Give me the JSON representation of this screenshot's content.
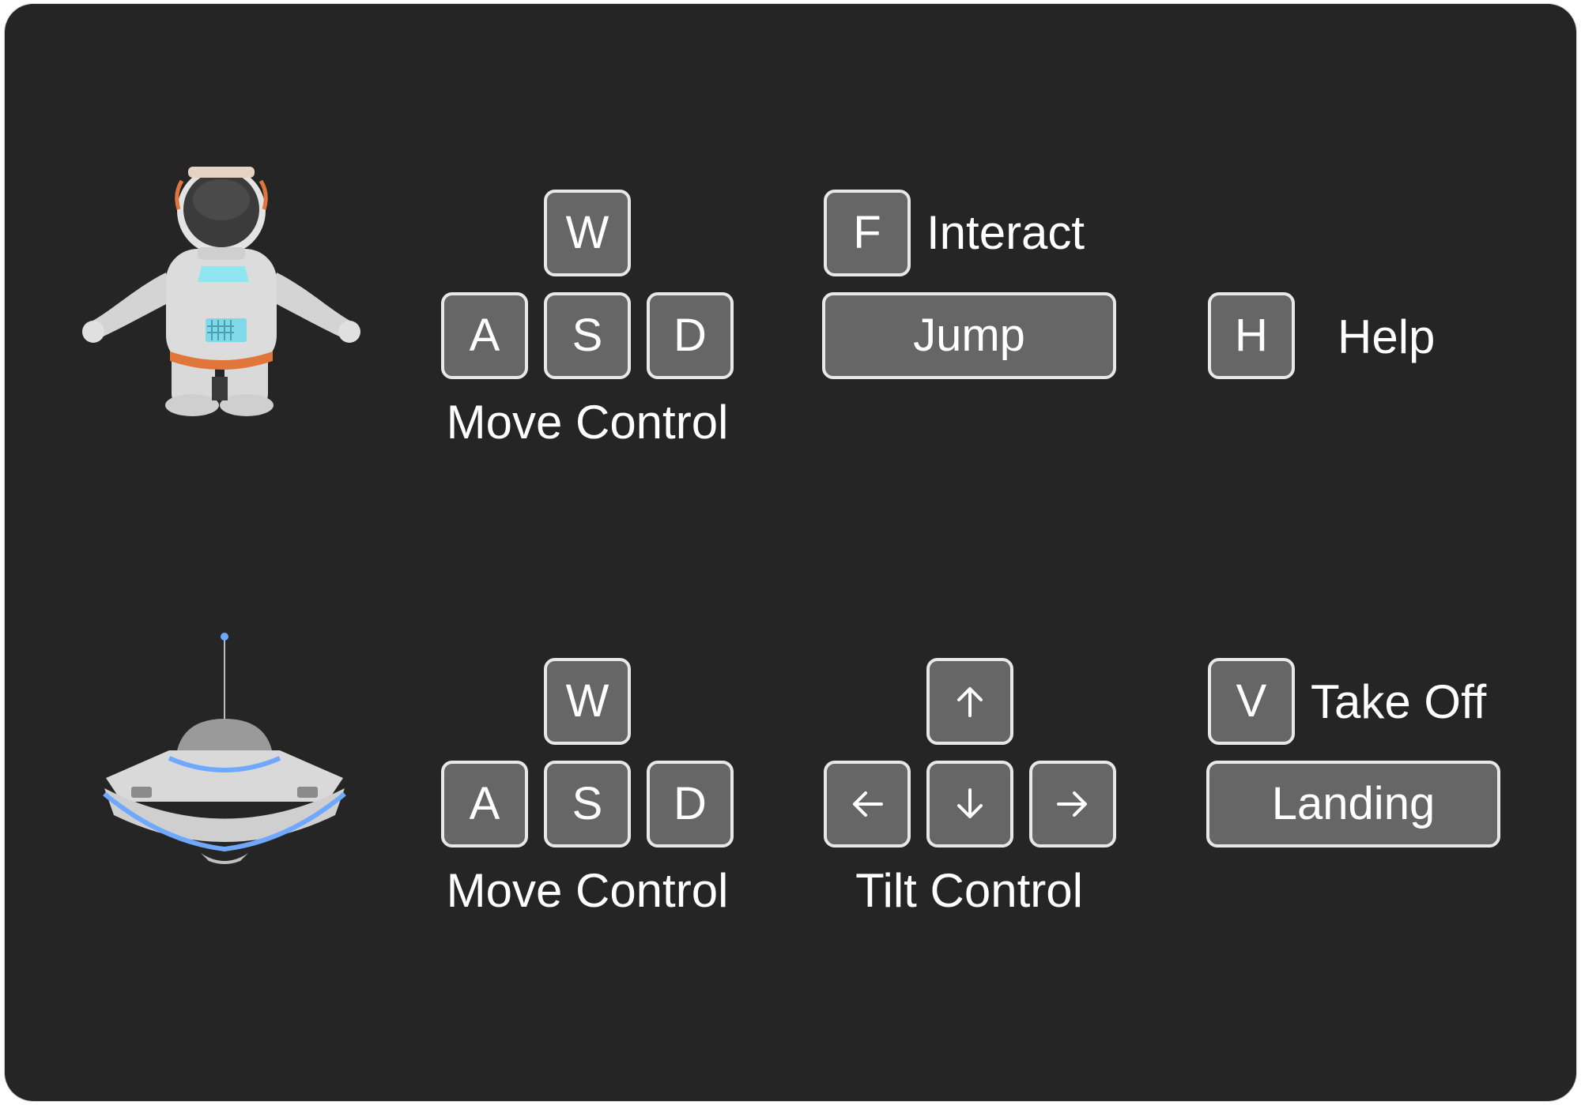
{
  "on_foot": {
    "move": {
      "keys": {
        "up": "W",
        "left": "A",
        "down": "S",
        "right": "D"
      },
      "label": "Move Control"
    },
    "interact": {
      "key": "F",
      "label": "Interact"
    },
    "jump": {
      "label": "Jump"
    },
    "help": {
      "key": "H",
      "label": "Help"
    },
    "character_icon": "astronaut"
  },
  "vehicle": {
    "move": {
      "keys": {
        "up": "W",
        "left": "A",
        "down": "S",
        "right": "D"
      },
      "label": "Move Control"
    },
    "tilt": {
      "icons": [
        "arrow-up-icon",
        "arrow-left-icon",
        "arrow-down-icon",
        "arrow-right-icon"
      ],
      "label": "Tilt Control"
    },
    "takeoff": {
      "key": "V",
      "label": "Take Off"
    },
    "landing": {
      "label": "Landing"
    },
    "vehicle_icon": "spaceship"
  },
  "colors": {
    "background": "#252525",
    "key_fill": "#666666",
    "key_border": "#e8e8e8",
    "text": "#ffffff",
    "accent_orange": "#e0763a",
    "accent_blue": "#6fa8ff"
  }
}
